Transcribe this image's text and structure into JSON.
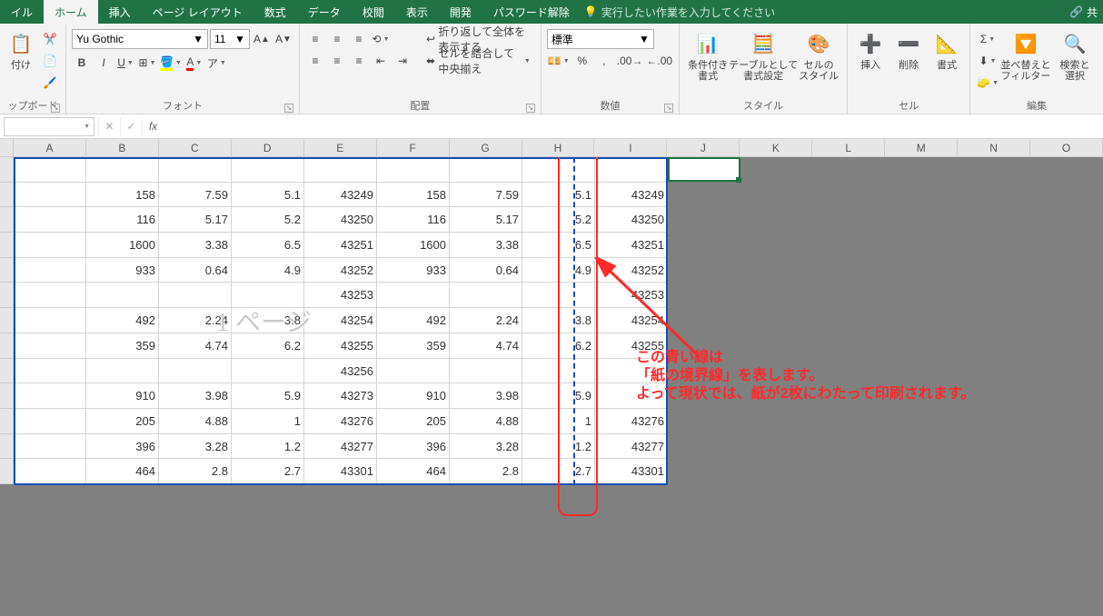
{
  "tabs": {
    "file": "イル",
    "home": "ホーム",
    "insert": "挿入",
    "page_layout": "ページ レイアウト",
    "formulas": "数式",
    "data": "データ",
    "review": "校閲",
    "view": "表示",
    "developer": "開発",
    "pw_unlock": "パスワード解除",
    "tellme": "実行したい作業を入力してください",
    "share": "共"
  },
  "ribbon": {
    "clipboard": {
      "group": "ップボード",
      "paste": "付け"
    },
    "font": {
      "group": "フォント",
      "name": "Yu Gothic",
      "size": "11",
      "bold": "B",
      "italic": "I",
      "underline": "U"
    },
    "align": {
      "group": "配置",
      "wrap": "折り返して全体を表示する",
      "merge": "セルを結合して中央揃え"
    },
    "number": {
      "group": "数値",
      "format": "標準",
      "percent": "%",
      "comma": ","
    },
    "styles": {
      "group": "スタイル",
      "cond": "条件付き\n書式",
      "table": "テーブルとして\n書式設定",
      "cell": "セルの\nスタイル"
    },
    "cells": {
      "group": "セル",
      "insert": "挿入",
      "delete": "削除",
      "format": "書式"
    },
    "editing": {
      "group": "編集",
      "sort": "並べ替えと\nフィルター",
      "find": "検索と\n選択"
    }
  },
  "columns": [
    "A",
    "B",
    "C",
    "D",
    "E",
    "F",
    "G",
    "H",
    "I",
    "J",
    "K",
    "L",
    "M",
    "N",
    "O"
  ],
  "watermark": "1 ページ",
  "rows": [
    [
      "",
      "",
      "",
      "",
      "",
      "",
      "",
      "",
      "",
      ""
    ],
    [
      "",
      "158",
      "7.59",
      "5.1",
      "43249",
      "158",
      "7.59",
      "5.1",
      "43249",
      ""
    ],
    [
      "",
      "116",
      "5.17",
      "5.2",
      "43250",
      "116",
      "5.17",
      "5.2",
      "43250",
      ""
    ],
    [
      "",
      "1600",
      "3.38",
      "6.5",
      "43251",
      "1600",
      "3.38",
      "6.5",
      "43251",
      ""
    ],
    [
      "",
      "933",
      "0.64",
      "4.9",
      "43252",
      "933",
      "0.64",
      "4.9",
      "43252",
      ""
    ],
    [
      "",
      "",
      "",
      "",
      "43253",
      "",
      "",
      "",
      "43253",
      ""
    ],
    [
      "",
      "492",
      "2.24",
      "3.8",
      "43254",
      "492",
      "2.24",
      "3.8",
      "43254",
      ""
    ],
    [
      "",
      "359",
      "4.74",
      "6.2",
      "43255",
      "359",
      "4.74",
      "6.2",
      "43255",
      ""
    ],
    [
      "",
      "",
      "",
      "",
      "43256",
      "",
      "",
      "",
      "",
      ""
    ],
    [
      "",
      "910",
      "3.98",
      "5.9",
      "43273",
      "910",
      "3.98",
      "5.9",
      "",
      ""
    ],
    [
      "",
      "205",
      "4.88",
      "1",
      "43276",
      "205",
      "4.88",
      "1",
      "43276",
      ""
    ],
    [
      "",
      "396",
      "3.28",
      "1.2",
      "43277",
      "396",
      "3.28",
      "1.2",
      "43277",
      ""
    ],
    [
      "",
      "464",
      "2.8",
      "2.7",
      "43301",
      "464",
      "2.8",
      "2.7",
      "43301",
      ""
    ]
  ],
  "annotation": {
    "l1": "この青い線は",
    "l2": "「紙の境界線」を表します。",
    "l3": "よって現状では、紙が2枚にわたって印刷されます。"
  }
}
